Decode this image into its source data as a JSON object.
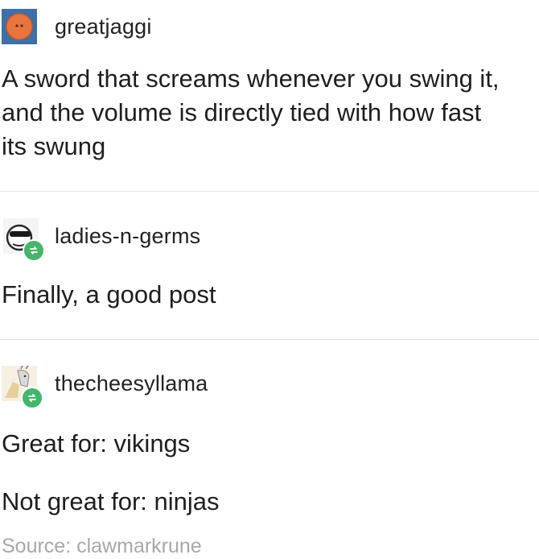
{
  "posts": [
    {
      "username": "greatjaggi",
      "avatar_icon": "orange-circle-face-icon",
      "lines": [
        "A sword that screams whenever you swing it,",
        "and the volume is directly tied with how fast",
        "its swung"
      ]
    },
    {
      "username": "ladies-n-germs",
      "avatar_icon": "sunglasses-face-icon",
      "reblog_icon": "reblog-icon",
      "lines": [
        "Finally, a good post"
      ]
    },
    {
      "username": "thecheesyllama",
      "avatar_icon": "llama-drawing-icon",
      "reblog_icon": "reblog-icon",
      "lines": [
        "Great for: vikings",
        "Not great for: ninjas"
      ]
    }
  ],
  "source": "Source: clawmarkrune",
  "colors": {
    "reblog_badge": "#44b66a",
    "avatar_orange": "#e8743f",
    "avatar_blue": "#3e6fa6",
    "source_text": "#a8a8a8"
  }
}
